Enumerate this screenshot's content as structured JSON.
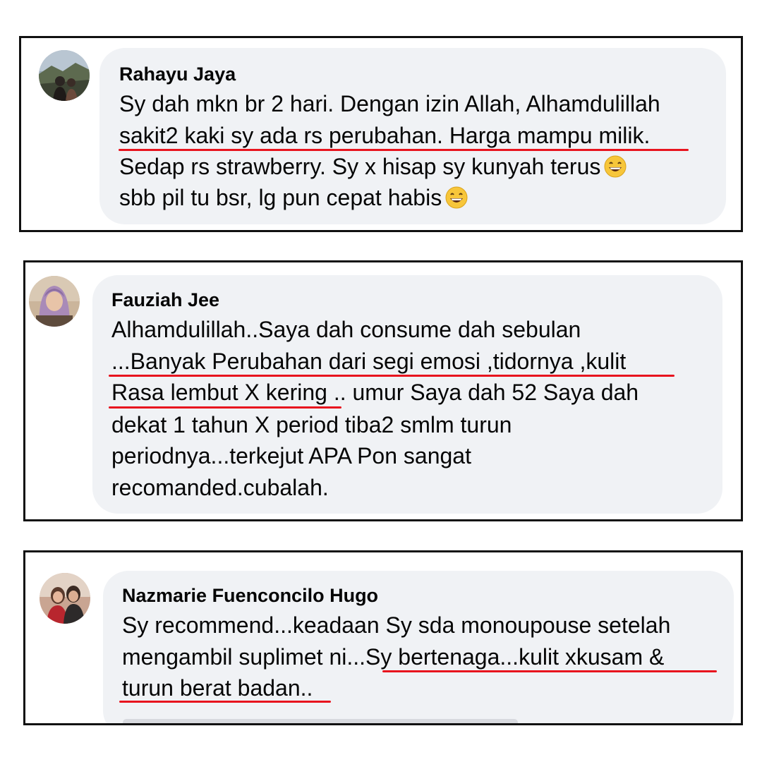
{
  "comments": [
    {
      "author": "Rahayu Jaya",
      "lines": [
        "Sy dah mkn br 2 hari. Dengan izin Allah, Alhamdulillah",
        "sakit2 kaki sy ada rs perubahan. Harga mampu milik.",
        "Sedap rs strawberry. Sy x hisap sy kunyah terus",
        "sbb pil tu bsr, lg pun cepat habis"
      ],
      "emojis": [
        "grinning-face-with-smiling-eyes",
        "grinning-face-with-smiling-eyes"
      ]
    },
    {
      "author": "Fauziah Jee",
      "lines": [
        "Alhamdulillah..Saya dah consume dah sebulan",
        "...Banyak Perubahan dari segi emosi ,tidornya ,kulit",
        "Rasa lembut X kering .. umur Saya dah 52 Saya dah",
        "dekat 1 tahun X period tiba2 smlm turun",
        "periodnya...terkejut APA Pon sangat",
        "recomanded.cubalah."
      ]
    },
    {
      "author": "Nazmarie Fuenconcilo Hugo",
      "lines": [
        "Sy recommend...keadaan Sy sda monoupouse setelah",
        "mengambil suplimet ni...Sy bertenaga...kulit xkusam &",
        "turun berat badan.."
      ]
    }
  ],
  "colors": {
    "bubble": "#f0f2f5",
    "highlight_underline": "#e8141e",
    "frame_border": "#111111",
    "text": "#050505"
  }
}
